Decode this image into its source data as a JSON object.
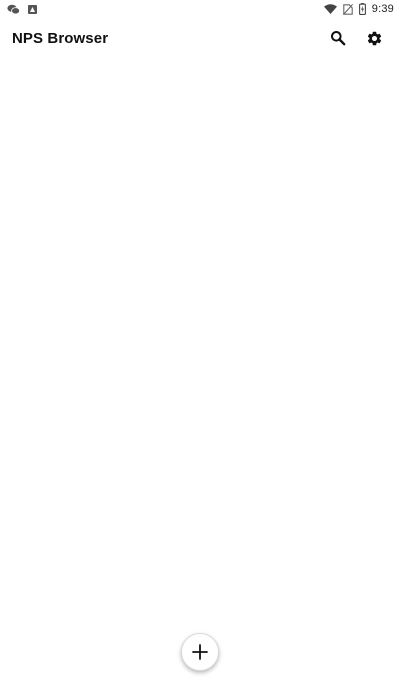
{
  "status_bar": {
    "time": "9:39",
    "left_icons": [
      "chat-notification-icon",
      "app-notification-icon"
    ],
    "right_icons": [
      "wifi-icon",
      "no-sim-icon",
      "battery-charging-icon"
    ]
  },
  "app_bar": {
    "title": "NPS Browser",
    "actions": [
      "search-icon",
      "gear-icon"
    ]
  },
  "fab": {
    "icon": "plus-icon"
  }
}
